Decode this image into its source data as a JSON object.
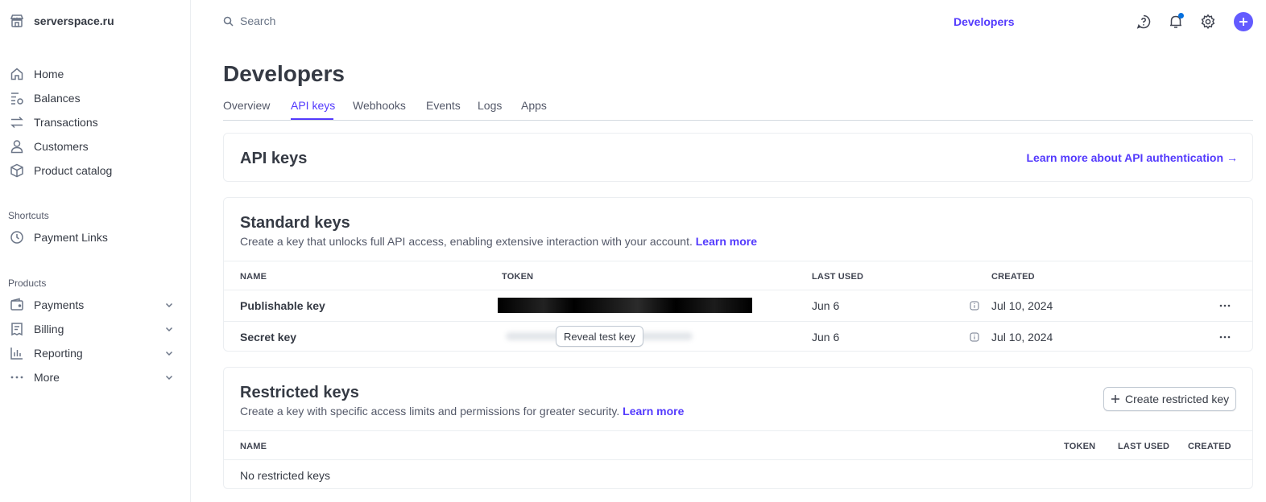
{
  "sidebar": {
    "account": {
      "name": "serverspace.ru",
      "icon": "store-icon"
    },
    "nav": [
      {
        "label": "Home",
        "icon": "home-icon"
      },
      {
        "label": "Balances",
        "icon": "balances-icon"
      },
      {
        "label": "Transactions",
        "icon": "transactions-icon"
      },
      {
        "label": "Customers",
        "icon": "customers-icon"
      },
      {
        "label": "Product catalog",
        "icon": "product-catalog-icon"
      }
    ],
    "shortcuts_label": "Shortcuts",
    "shortcuts": [
      {
        "label": "Payment Links",
        "icon": "clock-icon"
      }
    ],
    "products_label": "Products",
    "products": [
      {
        "label": "Payments",
        "icon": "wallet-icon"
      },
      {
        "label": "Billing",
        "icon": "billing-icon"
      },
      {
        "label": "Reporting",
        "icon": "bar-chart-icon"
      },
      {
        "label": "More",
        "icon": "ellipsis-icon"
      }
    ]
  },
  "topbar": {
    "search_placeholder": "Search",
    "developers_link": "Developers",
    "icons": [
      "help-icon",
      "bell-icon",
      "settings-icon",
      "plus-icon"
    ]
  },
  "page": {
    "title": "Developers",
    "tabs": [
      "Overview",
      "API keys",
      "Webhooks",
      "Events",
      "Logs",
      "Apps"
    ],
    "active_tab": "API keys"
  },
  "api_keys_card": {
    "title": "API keys",
    "learn_more": "Learn more about API authentication",
    "arrow": "→"
  },
  "standard_keys": {
    "title": "Standard keys",
    "description": "Create a key that unlocks full API access, enabling extensive interaction with your account.",
    "learn_more": "Learn more",
    "columns": [
      "NAME",
      "TOKEN",
      "LAST USED",
      "CREATED"
    ],
    "rows": [
      {
        "name": "Publishable key",
        "last_used": "Jun 6",
        "created": "Jul 10, 2024"
      },
      {
        "name": "Secret key",
        "reveal_button": "Reveal test key",
        "last_used": "Jun 6",
        "created": "Jul 10, 2024"
      }
    ]
  },
  "restricted_keys": {
    "title": "Restricted keys",
    "description": "Create a key with specific access limits and permissions for greater security.",
    "learn_more": "Learn more",
    "create_button": "Create restricted key",
    "columns": [
      "NAME",
      "TOKEN",
      "LAST USED",
      "CREATED"
    ],
    "empty_text": "No restricted keys"
  },
  "colors": {
    "accent": "#533afd",
    "plus_button": "#635bff",
    "notification_badge": "#0570de"
  }
}
